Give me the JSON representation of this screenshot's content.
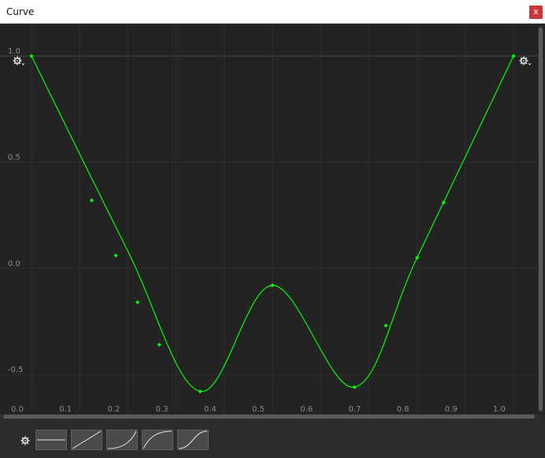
{
  "window": {
    "title": "Curve",
    "close_label": "x"
  },
  "y_axis": {
    "ticks": [
      {
        "value": 1.0,
        "label": "1.0"
      },
      {
        "value": 0.5,
        "label": "0.5"
      },
      {
        "value": 0.0,
        "label": "0.0"
      },
      {
        "value": -0.5,
        "label": "-0.5"
      }
    ]
  },
  "x_axis": {
    "ticks": [
      {
        "value": 0.0,
        "label": "0.0"
      },
      {
        "value": 0.1,
        "label": "0.1"
      },
      {
        "value": 0.2,
        "label": "0.2"
      },
      {
        "value": 0.3,
        "label": "0.3"
      },
      {
        "value": 0.4,
        "label": "0.4"
      },
      {
        "value": 0.5,
        "label": "0.5"
      },
      {
        "value": 0.6,
        "label": "0.6"
      },
      {
        "value": 0.7,
        "label": "0.7"
      },
      {
        "value": 0.8,
        "label": "0.8"
      },
      {
        "value": 0.9,
        "label": "0.9"
      },
      {
        "value": 1.0,
        "label": "1.0"
      }
    ]
  },
  "curve": {
    "color": "#00ff00",
    "keys": [
      {
        "time": 0.0,
        "value": 1.0
      },
      {
        "time": 0.2,
        "value": 0.08
      },
      {
        "time": 0.35,
        "value": -0.58
      },
      {
        "time": 0.5,
        "value": -0.08
      },
      {
        "time": 0.67,
        "value": -0.56
      },
      {
        "time": 0.8,
        "value": 0.05
      },
      {
        "time": 1.0,
        "value": 1.0
      }
    ],
    "markers": [
      {
        "time": 0.0,
        "value": 1.0
      },
      {
        "time": 0.125,
        "value": 0.32
      },
      {
        "time": 0.175,
        "value": 0.06
      },
      {
        "time": 0.22,
        "value": -0.16
      },
      {
        "time": 0.265,
        "value": -0.36
      },
      {
        "time": 0.35,
        "value": -0.58
      },
      {
        "time": 0.5,
        "value": -0.08
      },
      {
        "time": 0.67,
        "value": -0.56
      },
      {
        "time": 0.735,
        "value": -0.27
      },
      {
        "time": 0.8,
        "value": 0.05
      },
      {
        "time": 0.855,
        "value": 0.31
      },
      {
        "time": 1.0,
        "value": 1.0
      }
    ]
  },
  "presets": [
    {
      "name": "constant",
      "label": "Constant"
    },
    {
      "name": "linear",
      "label": "Linear"
    },
    {
      "name": "ease-in",
      "label": "Ease In"
    },
    {
      "name": "ease-out",
      "label": "Ease Out"
    },
    {
      "name": "ease-in-out",
      "label": "Ease In Out"
    }
  ]
}
